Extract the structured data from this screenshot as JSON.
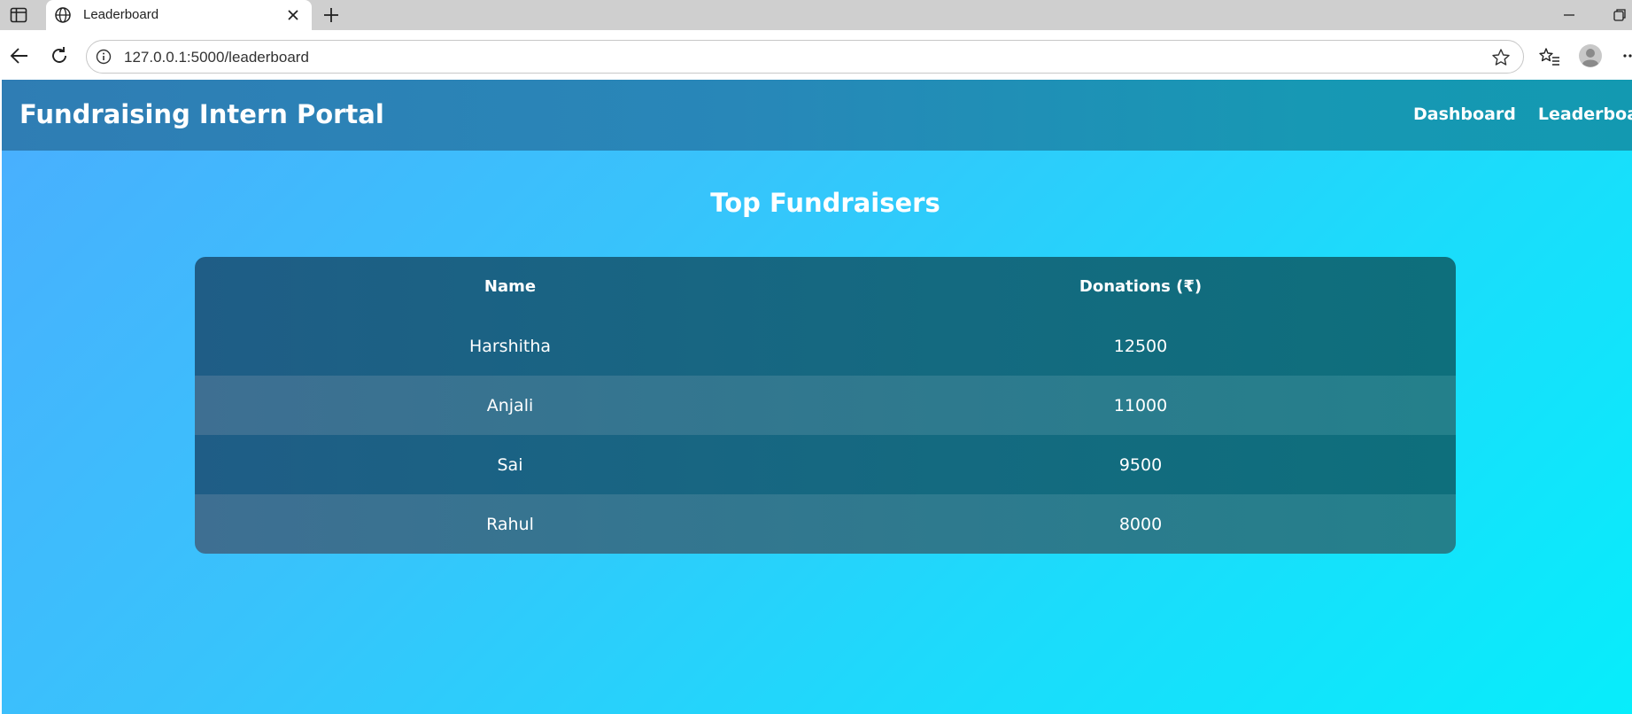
{
  "browser": {
    "tab_title": "Leaderboard",
    "url": "127.0.0.1:5000/leaderboard"
  },
  "site": {
    "brand": "Fundraising Intern Portal",
    "nav": [
      "Dashboard",
      "Leaderboard"
    ]
  },
  "leaderboard": {
    "heading": "Top Fundraisers",
    "columns": [
      "Name",
      "Donations (₹)"
    ],
    "rows": [
      {
        "name": "Harshitha",
        "donations": "12500"
      },
      {
        "name": "Anjali",
        "donations": "11000"
      },
      {
        "name": "Sai",
        "donations": "9500"
      },
      {
        "name": "Rahul",
        "donations": "8000"
      }
    ]
  },
  "colors": {
    "page_gradient_start": "#4aaefe",
    "page_gradient_end": "#07edfb",
    "nav_background": "#2887b8",
    "table_row_dark": "#146a80",
    "table_row_light": "#2e7a8e",
    "text": "#ffffff"
  }
}
